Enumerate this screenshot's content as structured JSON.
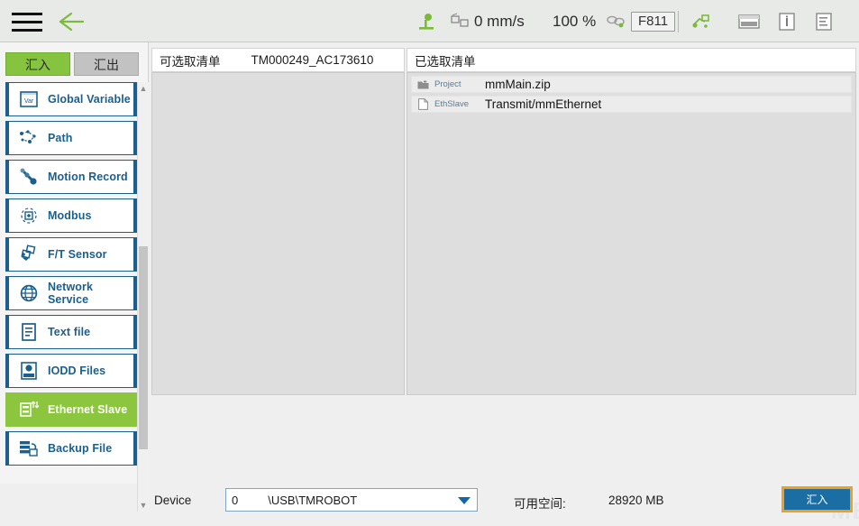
{
  "topbar": {
    "menu_icon": "hamburger-icon",
    "back_icon": "back-arrow-icon",
    "robot_icon": "robot-base-icon",
    "speed_icon": "speed-icon",
    "speed_value": "0 mm/s",
    "percent_value": "100 %",
    "eye_icon": "eye-toggle-icon",
    "project_code": "F811",
    "flow_icon": "flow-node-icon",
    "keyboard_icon": "keyboard-icon",
    "info_icon": "info-icon",
    "log_icon": "log-list-icon"
  },
  "sidebar": {
    "tabs": [
      {
        "label": "汇入",
        "active": true
      },
      {
        "label": "汇出",
        "active": false
      }
    ],
    "items": [
      {
        "label": "Global Variable",
        "icon": "variable-icon",
        "selected": false
      },
      {
        "label": "Path",
        "icon": "path-icon",
        "selected": false
      },
      {
        "label": "Motion Record",
        "icon": "motion-record-icon",
        "selected": false
      },
      {
        "label": "Modbus",
        "icon": "modbus-icon",
        "selected": false
      },
      {
        "label": "F/T Sensor",
        "icon": "ft-sensor-icon",
        "selected": false
      },
      {
        "label": "Network Service",
        "icon": "globe-icon",
        "selected": false
      },
      {
        "label": "Text file",
        "icon": "text-file-icon",
        "selected": false
      },
      {
        "label": "IODD Files",
        "icon": "iodd-files-icon",
        "selected": false
      },
      {
        "label": "Ethernet Slave",
        "icon": "ethernet-slave-icon",
        "selected": true
      },
      {
        "label": "Backup File",
        "icon": "backup-file-icon",
        "selected": false
      }
    ],
    "scroll_up_icon": "chevron-up-icon",
    "scroll_down_icon": "chevron-down-icon"
  },
  "main": {
    "available_panel": {
      "title": "可选取清单",
      "subtitle": "TM000249_AC173610",
      "rows": []
    },
    "selected_panel": {
      "title": "已选取清单",
      "rows": [
        {
          "type": "Project",
          "name": "mmMain.zip",
          "icon": "folder-zip-icon"
        },
        {
          "type": "EthSlave",
          "name": "Transmit/mmEthernet",
          "icon": "file-icon"
        }
      ]
    }
  },
  "bottom": {
    "device_label": "Device",
    "device_number": "0",
    "device_path": "\\USB\\TMROBOT",
    "dropdown_icon": "caret-down-icon",
    "space_label": "可用空间:",
    "space_value": "28920 MB",
    "import_button": "汇入"
  },
  "watermark": {
    "text": "MECH-MIND"
  },
  "colors": {
    "accent_green": "#8cc63f",
    "nav_blue": "#1a5f8e",
    "button_blue": "#1b6ea3",
    "focus_orange": "#f0a020",
    "panel_gray": "#dedede",
    "topbar_gray": "#e8eae8"
  }
}
